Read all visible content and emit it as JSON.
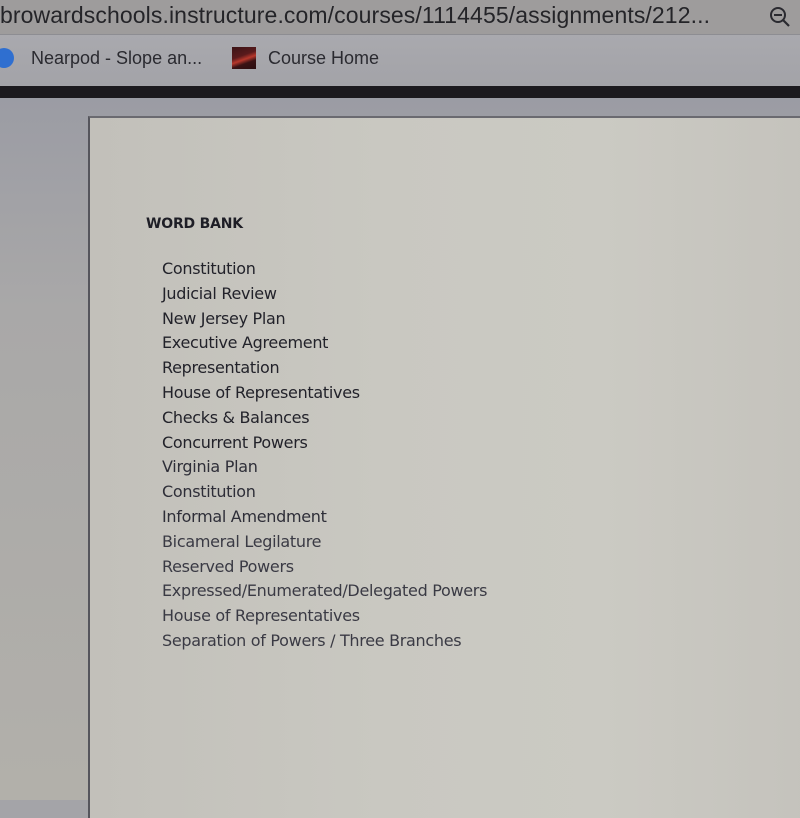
{
  "browser": {
    "url": "browardschools.instructure.com/courses/1114455/assignments/212...",
    "zoom_icon": "zoom-out-icon",
    "bookmarks": [
      {
        "label": "Nearpod - Slope an...",
        "icon": "nearpod-icon"
      },
      {
        "label": "Course Home",
        "icon": "course-home-icon"
      }
    ]
  },
  "document": {
    "heading": "WORD BANK",
    "words": [
      "Constitution",
      "Judicial Review",
      "New Jersey Plan",
      "Executive Agreement",
      "Representation",
      "House of Representatives",
      "Checks & Balances",
      "Concurrent Powers",
      "Virginia Plan",
      "Constitution",
      "Informal Amendment",
      "Bicameral Legilature",
      "Reserved Powers",
      "Expressed/Enumerated/Delegated Powers",
      "House of Representatives",
      "Separation of Powers / Three Branches"
    ]
  }
}
